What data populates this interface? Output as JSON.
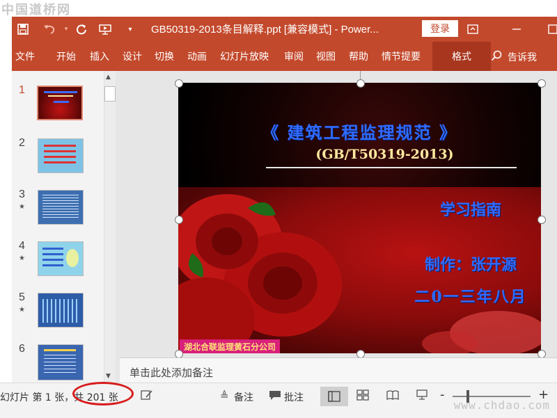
{
  "watermark": {
    "top": "中国道桥网",
    "bottom": "www.chdao.com"
  },
  "titlebar": {
    "title": "GB50319-2013条目解释.ppt [兼容模式] - Power...",
    "login_label": "登录"
  },
  "ribbon": {
    "tabs": [
      "文件",
      "开始",
      "插入",
      "设计",
      "切换",
      "动画",
      "幻灯片放映",
      "审阅",
      "视图",
      "帮助",
      "情节提要"
    ],
    "format_tab": "格式",
    "tell_me": "告诉我"
  },
  "thumbnails": {
    "items": [
      {
        "num": "1",
        "star": ""
      },
      {
        "num": "2",
        "star": ""
      },
      {
        "num": "3",
        "star": "★"
      },
      {
        "num": "4",
        "star": "★"
      },
      {
        "num": "5",
        "star": "★"
      },
      {
        "num": "6",
        "star": ""
      }
    ]
  },
  "slide": {
    "title": "《 建筑工程监理规范 》",
    "subtitle": "(GB/T50319-2013)",
    "guide": "学习指南",
    "author": "制作：张开源",
    "date": "二0一三年八月",
    "company": "湖北合联监理黄石分公司"
  },
  "notes": {
    "placeholder": "单击此处添加备注"
  },
  "statusbar": {
    "slide_info": "幻灯片 第 1 张，共 201 张",
    "notes_label": "备注",
    "comments_label": "批注",
    "zoom_minus": "-",
    "zoom_plus": "+"
  },
  "colors": {
    "accent": "#c3492c",
    "annotation": "#d81b1b",
    "slide_text": "#2f6bff"
  }
}
